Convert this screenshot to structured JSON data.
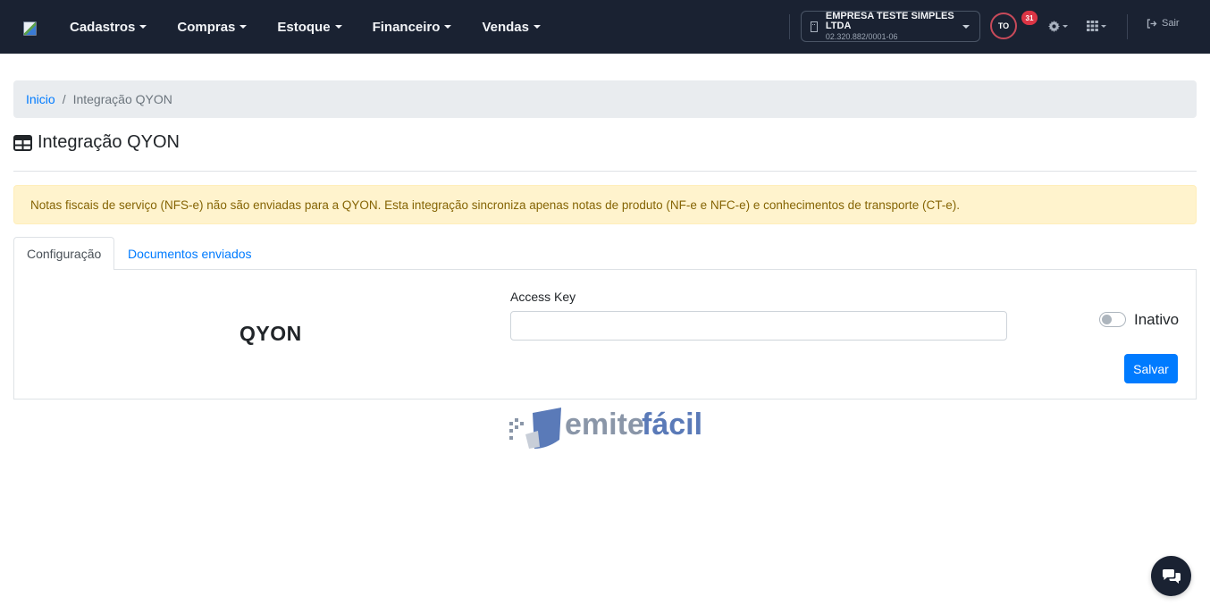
{
  "header": {
    "nav": [
      "Cadastros",
      "Compras",
      "Estoque",
      "Financeiro",
      "Vendas"
    ],
    "company": {
      "name": "EMPRESA TESTE SIMPLES LTDA",
      "cnpj": "02.320.882/0001-06"
    },
    "avatar_initials": "TO",
    "notification_count": "31",
    "logout_label": "Sair"
  },
  "breadcrumb": {
    "home": "Inicio",
    "current": "Integração QYON"
  },
  "page": {
    "title": "Integração QYON"
  },
  "alert": {
    "text": "Notas fiscais de serviço (NFS-e) não são enviadas para a QYON. Esta integração sincroniza apenas notas de produto (NF-e e NFC-e) e conhecimentos de transporte (CT-e)."
  },
  "tabs": [
    {
      "label": "Configuração"
    },
    {
      "label": "Documentos enviados"
    }
  ],
  "config": {
    "provider_name": "QYON",
    "access_key_label": "Access Key",
    "access_key_value": "",
    "status_label": "Inativo",
    "status_on": false,
    "save_label": "Salvar"
  },
  "footer": {
    "logo_text_a": "emite",
    "logo_text_b": "fácil"
  },
  "colors": {
    "topbar": "#1a2232",
    "primary": "#007bff",
    "alert_bg": "#fff3cd",
    "alert_text": "#856404",
    "badge": "#dc3545"
  },
  "icons": [
    "building-icon",
    "settings-gear-icon",
    "apps-grid-icon",
    "logout-icon",
    "table-icon",
    "chat-icon"
  ]
}
